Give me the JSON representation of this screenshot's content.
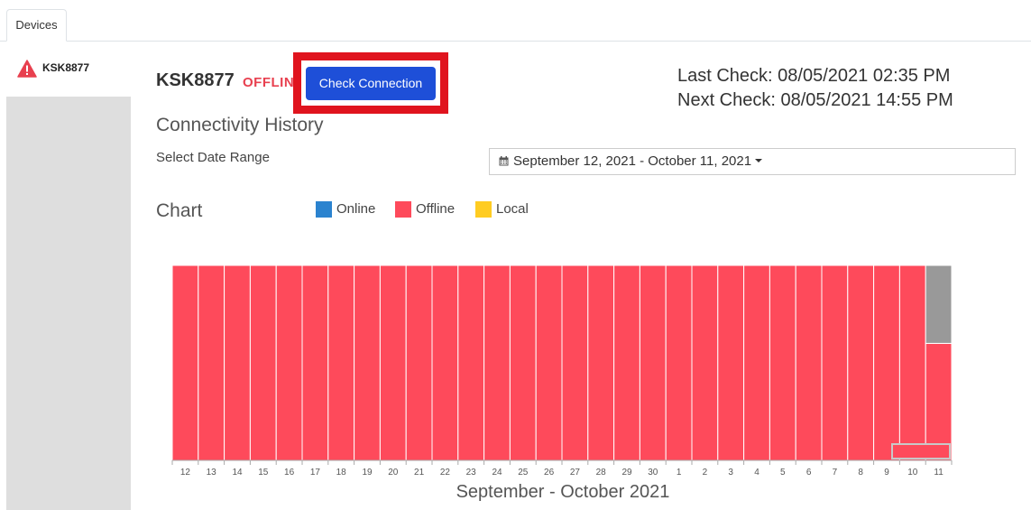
{
  "tabs": {
    "devices_label": "Devices"
  },
  "sidebar": {
    "device_label": "KSK8877",
    "device_icon": "warning-icon"
  },
  "device": {
    "name": "KSK8877",
    "status": "OFFLINE",
    "check_button_label": "Check Connection"
  },
  "checks": {
    "last": "Last Check: 08/05/2021 02:35 PM",
    "next": "Next Check: 08/05/2021 14:55 PM"
  },
  "history": {
    "title": "Connectivity History",
    "range_label": "Select Date Range",
    "range_value": "September 12, 2021 - October 11, 2021"
  },
  "chart_section": {
    "title": "Chart"
  },
  "legend": [
    {
      "label": "Online",
      "color": "#2b83cf"
    },
    {
      "label": "Offline",
      "color": "#fe4a5b"
    },
    {
      "label": "Local",
      "color": "#ffcc22"
    }
  ],
  "colors": {
    "accent": "#1e4fd8",
    "highlight": "#e0141e",
    "offline": "#fe4a5b",
    "unknown": "#999999"
  },
  "chart_data": {
    "type": "bar",
    "stacked": true,
    "xlabel": "September - October 2021",
    "categories": [
      "12",
      "13",
      "14",
      "15",
      "16",
      "17",
      "18",
      "19",
      "20",
      "21",
      "22",
      "23",
      "24",
      "25",
      "26",
      "27",
      "28",
      "29",
      "30",
      "1",
      "2",
      "3",
      "4",
      "5",
      "6",
      "7",
      "8",
      "9",
      "10",
      "11"
    ],
    "series": [
      {
        "name": "Offline",
        "color": "#fe4a5b",
        "values": [
          1,
          1,
          1,
          1,
          1,
          1,
          1,
          1,
          1,
          1,
          1,
          1,
          1,
          1,
          1,
          1,
          1,
          1,
          1,
          1,
          1,
          1,
          1,
          1,
          1,
          1,
          1,
          1,
          1,
          0.6
        ]
      },
      {
        "color": "#999999",
        "values": [
          0,
          0,
          0,
          0,
          0,
          0,
          0,
          0,
          0,
          0,
          0,
          0,
          0,
          0,
          0,
          0,
          0,
          0,
          0,
          0,
          0,
          0,
          0,
          0,
          0,
          0,
          0,
          0,
          0,
          0.4
        ]
      }
    ],
    "ylim": [
      0,
      1
    ],
    "grid": false
  }
}
